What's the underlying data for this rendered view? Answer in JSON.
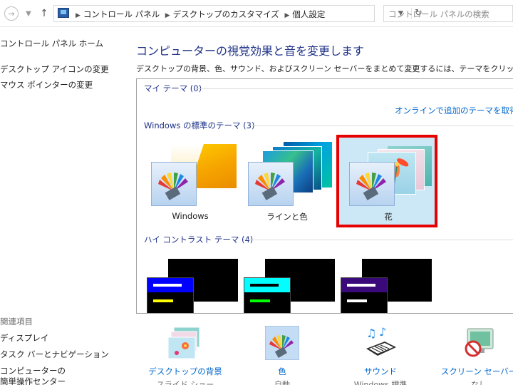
{
  "address_bar": {
    "breadcrumbs": [
      "コントロール パネル",
      "デスクトップのカスタマイズ",
      "個人設定"
    ],
    "search_placeholder": "コントロール パネルの検索"
  },
  "sidebar": {
    "links": [
      "コントロール パネル ホーム",
      "デスクトップ アイコンの変更",
      "マウス ポインターの変更"
    ],
    "related_heading": "関連項目",
    "related_links": [
      "ディスプレイ",
      "タスク バーとナビゲーション",
      "コンピューターの",
      "簡単操作センター"
    ]
  },
  "main": {
    "title": "コンピューターの視覚効果と音を変更します",
    "description": "デスクトップの背景、色、サウンド、およびスクリーン セーバーをまとめて変更するには、テーマをクリックします。",
    "my_themes_heading": "マイ テーマ (0)",
    "online_link": "オンラインで追加のテーマを取得",
    "windows_themes_heading": "Windows の標準のテーマ (3)",
    "themes": [
      {
        "label": "Windows",
        "selected": false
      },
      {
        "label": "ラインと色",
        "selected": false
      },
      {
        "label": "花",
        "selected": true
      }
    ],
    "high_contrast_heading": "ハイ コントラスト テーマ (4)",
    "high_contrast_accents": [
      "#0000ff",
      "#00ffff",
      "#3a0a7a"
    ]
  },
  "bottom": [
    {
      "label": "デスクトップの背景",
      "sub": "スライド ショー",
      "icon": "desktop-background-icon"
    },
    {
      "label": "色",
      "sub": "自動",
      "icon": "color-icon"
    },
    {
      "label": "サウンド",
      "sub": "Windows 標準",
      "icon": "sound-icon"
    },
    {
      "label": "スクリーン セーバー",
      "sub": "なし",
      "icon": "screen-saver-icon"
    }
  ],
  "colors": {
    "title": "#1e3287",
    "link": "#0066cc",
    "selected_bg": "#cce8f6",
    "highlight": "#e60000"
  }
}
